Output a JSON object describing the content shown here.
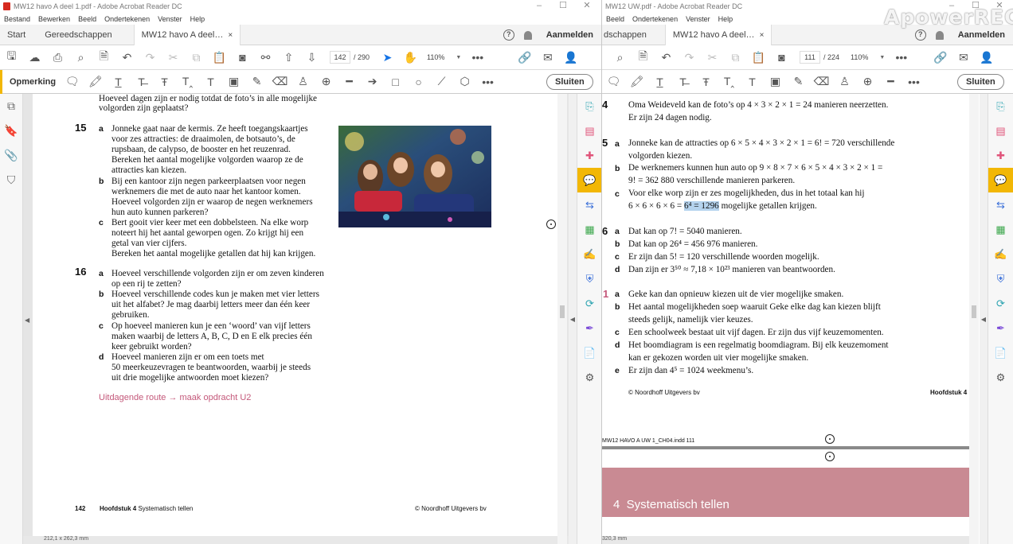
{
  "left": {
    "title": "MW12 havo A deel 1.pdf - Adobe Acrobat Reader DC",
    "menu": [
      "Bestand",
      "Bewerken",
      "Beeld",
      "Ondertekenen",
      "Venster",
      "Help"
    ],
    "tabs": {
      "start": "Start",
      "tools": "Gereedschappen",
      "doc": "MW12 havo A deel…",
      "close": "×"
    },
    "signin": "Aanmelden",
    "page_current": "142",
    "page_total": "/ 290",
    "zoom": "110%",
    "comment_title": "Opmerking",
    "close_label": "Sluiten",
    "doc": {
      "top1": "Hoeveel dagen zijn er nodig totdat de foto’s in alle mogelijke",
      "top2": "volgorden zijn geplaatst?",
      "q15": "15",
      "q15a": [
        "Jonneke gaat naar de kermis. Ze heeft toegangskaartjes",
        "voor zes attracties: de draaimolen, de botsauto’s, de",
        "rupsbaan, de calypso, de booster en het reuzenrad.",
        "Bereken het aantal mogelijke volgorden waarop ze de",
        "attracties kan kiezen."
      ],
      "q15b": [
        "Bij een kantoor zijn negen parkeerplaatsen voor negen",
        "werknemers die met de auto naar het kantoor komen.",
        "Hoeveel volgorden zijn er waarop de negen werknemers",
        "hun auto kunnen parkeren?"
      ],
      "q15c": [
        "Bert gooit vier keer met een dobbelsteen. Na elke worp",
        "noteert hij het aantal geworpen ogen. Zo krijgt hij een",
        "getal van vier cijfers.",
        "Bereken het aantal mogelijke getallen dat hij kan krijgen."
      ],
      "q16": "16",
      "q16a": [
        "Hoeveel verschillende volgorden zijn er om zeven kinderen",
        "op een rij te zetten?"
      ],
      "q16b": [
        "Hoeveel verschillende codes kun je maken met vier letters",
        "uit het alfabet? Je mag daarbij letters meer dan één keer",
        "gebruiken."
      ],
      "q16c": [
        "Op hoeveel manieren kun je een ‘woord’ van vijf letters",
        "maken waarbij de letters A, B, C, D en E elk precies één",
        "keer gebruikt worden?"
      ],
      "q16d": [
        "Hoeveel manieren zijn er om een toets met",
        "50 meerkeuzevragen te beantwoorden, waarbij je steeds",
        "uit drie mogelijke antwoorden moet kiezen?"
      ],
      "route": "Uitdagende route → maak opdracht U2",
      "footer_page": "142",
      "footer_chapter_bold": "Hoofdstuk 4",
      "footer_chapter": " Systematisch tellen",
      "footer_copy": "© Noordhoff Uitgevers bv"
    },
    "status": "212,1 x 262,3 mm"
  },
  "right": {
    "title": "MW12 UW.pdf - Adobe Acrobat Reader DC",
    "menu": [
      "Beeld",
      "Ondertekenen",
      "Venster",
      "Help"
    ],
    "tabs": {
      "tools": "dschappen",
      "doc": "MW12 havo A deel…",
      "close": "×"
    },
    "signin": "Aanmelden",
    "page_current": "111",
    "page_total": "/ 224",
    "zoom": "110%",
    "close_label": "Sluiten",
    "doc": {
      "n4": "4",
      "a4": [
        "Oma Weideveld kan de foto’s op 4 × 3 × 2 × 1 = 24 manieren neerzetten.",
        "Er zijn 24 dagen nodig."
      ],
      "n5": "5",
      "a5a": [
        "Jonneke kan de attracties op 6 × 5 × 4 × 3 × 2 × 1 = 6! = 720 verschillende",
        "volgorden kiezen."
      ],
      "a5b": [
        "De werknemers kunnen hun auto op 9 × 8 × 7 × 6 × 5 × 4 × 3 × 2 × 1 =",
        "9! = 362 880 verschillende manieren parkeren."
      ],
      "a5c1": "Voor elke worp zijn er zes mogelijkheden, dus in het totaal kan hij",
      "a5c2_pre": "6 × 6 × 6 × 6 = ",
      "a5c2_hl": "6⁴ = 1296",
      "a5c2_post": " mogelijke getallen krijgen.",
      "n6": "6",
      "a6": [
        "Dat kan op 7! = 5040 manieren.",
        "Dat kan op 26⁴ = 456 976 manieren.",
        "Er zijn dan 5! = 120 verschillende woorden mogelijk.",
        "Dan zijn er 3⁵⁰ ≈ 7,18 × 10²³ manieren van beantwoorden."
      ],
      "n1": "1",
      "u1a": "Geke kan dan opnieuw kiezen uit de vier mogelijke smaken.",
      "u1b": [
        "Het aantal mogelijkheden soep waaruit Geke elke dag kan kiezen blijft",
        "steeds gelijk, namelijk vier keuzes."
      ],
      "u1c": "Een schoolweek bestaat uit vijf dagen. Er zijn dus vijf keuzemomenten.",
      "u1d": [
        "Het boomdiagram is een regelmatig boomdiagram. Bij elk keuzemoment",
        "kan er gekozen worden uit vier mogelijke smaken."
      ],
      "u1e": "Er zijn dan 4⁵ = 1024 weekmenu’s.",
      "footer_copy": "© Noordhoff Uitgevers bv",
      "footer_chapter": "Hoofdstuk 4",
      "slug": "MW12 HAVO A UW 1_CH04.indd   111",
      "banner": "4  Systematisch tellen"
    },
    "status": "320,3 mm"
  },
  "watermark": "ApowerREC",
  "letters": {
    "a": "a",
    "b": "b",
    "c": "c",
    "d": "d",
    "e": "e"
  },
  "colors": {
    "accent": "#f2b705",
    "route": "#c4587a",
    "banner": "#c98a93",
    "highlight": "#b5d3ee"
  }
}
